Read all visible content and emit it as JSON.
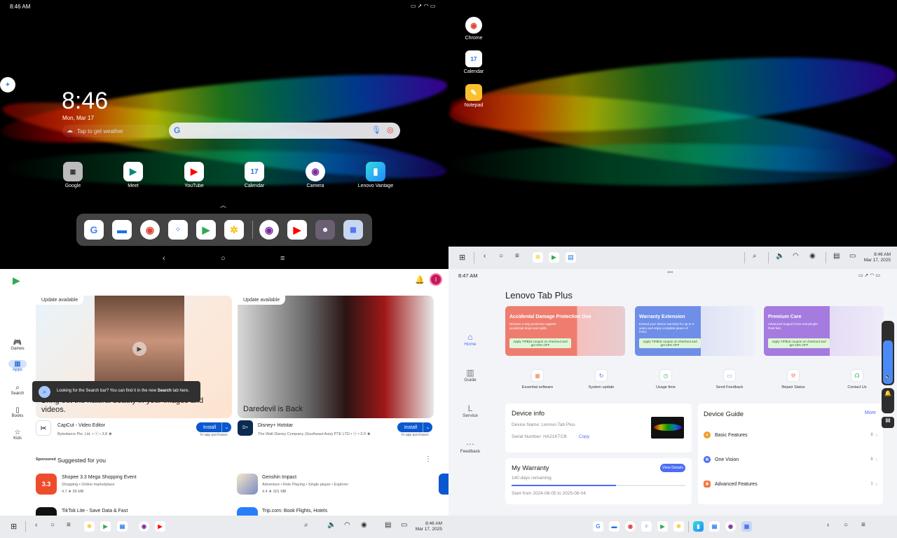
{
  "colors": {
    "play_blue": "#0b57d0",
    "lenovo_blue": "#4a6cf7",
    "promo1": "#ee7d6f",
    "promo2": "#6e8ee8",
    "promo3": "#a57be0"
  },
  "home": {
    "status_time": "8:46 AM",
    "clock": "8:46",
    "date": "Mon, Mar 17",
    "weather": "Tap to get weather",
    "apps": [
      {
        "label": "Google",
        "icon": "google-folder-icon"
      },
      {
        "label": "Meet",
        "icon": "meet-icon"
      },
      {
        "label": "YouTube",
        "icon": "youtube-icon"
      },
      {
        "label": "Calendar",
        "icon": "calendar-icon"
      },
      {
        "label": "Camera",
        "icon": "camera-icon"
      },
      {
        "label": "Lenovo Vantage",
        "icon": "lenovo-vantage-icon"
      }
    ],
    "calendar_day": "17"
  },
  "desktop": {
    "apps": [
      {
        "label": "Chrome",
        "icon": "chrome-icon"
      },
      {
        "label": "Calendar",
        "icon": "calendar-icon"
      },
      {
        "label": "Notepad",
        "icon": "notepad-icon"
      }
    ],
    "calendar_day": "17",
    "taskbar_time": "8:46 AM",
    "taskbar_date": "Mar 17, 2025"
  },
  "play": {
    "cards": [
      {
        "badge": "Update available",
        "caption": "Bring out the natural beauty in your images and videos.",
        "app": "CapCut - Video Editor",
        "dev": "Bytedance Pte. Ltd. • ⓔ • 3.8 ★",
        "install": "Install",
        "note": "In-app purchases"
      },
      {
        "badge": "Update available",
        "caption": "Daredevil is Back",
        "app": "Disney+ Hotstar",
        "dev": "The Walt Disney Company (Southeast Asia) PTE LTD • ⓔ • 3.0 ★",
        "install": "Install",
        "note": "In-app purchases"
      }
    ],
    "tooltip_prefix": "Looking for the Search bar? You can find it in the new ",
    "tooltip_bold": "Search",
    "tooltip_suffix": " tab here.",
    "sponsored": "Sponsored",
    "suggested": "Suggested for you",
    "list": [
      {
        "name": "Shopee 3.3 Mega Shopping Event",
        "cat": "Shopping • Online marketplace",
        "meta": "4.7 ★   95 MB",
        "icon_text": "3.3"
      },
      {
        "name": "Genshin Impact",
        "cat": "Adventure • Role Playing • Single player • Explorer",
        "meta": "4.4 ★   301 MB",
        "icon_text": ""
      },
      {
        "name": "TikTok Lite - Save Data & Fast",
        "cat": "",
        "meta": "",
        "icon_text": ""
      },
      {
        "name": "Trip.com: Book Flights, Hotels",
        "cat": "",
        "meta": "",
        "icon_text": ""
      }
    ],
    "nav": [
      {
        "label": "Games",
        "glyph": "🎮"
      },
      {
        "label": "Apps",
        "glyph": "▦"
      },
      {
        "label": "Search",
        "glyph": "⌕"
      },
      {
        "label": "Books",
        "glyph": "▯"
      },
      {
        "label": "Kids",
        "glyph": "☆"
      }
    ],
    "avatar": "I",
    "taskbar_time": "8:46 AM",
    "taskbar_date": "Mar 17, 2025"
  },
  "vantage": {
    "status_time": "8:47 AM",
    "title": "Lenovo Tab Plus",
    "nav": [
      {
        "label": "Home",
        "glyph": "⌂"
      },
      {
        "label": "Guide",
        "glyph": "▥"
      },
      {
        "label": "Service",
        "glyph": "L"
      },
      {
        "label": "Feedback",
        "glyph": "⋯"
      }
    ],
    "promos": [
      {
        "title": "Accidental Damage Protection One",
        "desc": "Receive a stop protection against accidental drops and spills.",
        "coupon": "Apply TIP$15 coupon on checkout and get 20% OFF"
      },
      {
        "title": "Warranty Extension",
        "desc": "Extend your device warranty for up to 3 years and enjoy complete peace of mind.",
        "coupon": "Apply TIP$15 coupon on checkout and get 15% OFF"
      },
      {
        "title": "Premium Care",
        "desc": "Advanced Support from real people. Real fast.",
        "coupon": "Apply TIP$15 coupon on checkout and get 15% OFF"
      }
    ],
    "quick": [
      "Essential software",
      "System update",
      "Usage time",
      "Send Feedback",
      "Repair Status",
      "Contact Us"
    ],
    "device_info": {
      "title": "Device info",
      "name": "Device Name: Lenovo Tab Plus",
      "serial": "Serial Number: HA21KTCB",
      "copy": "Copy"
    },
    "warranty": {
      "title": "My Warranty",
      "remaining": "140 days remaining",
      "range": "Start from 2024-08-05 to 2025-08-04",
      "details": "View Details",
      "progress": 0.6
    },
    "guide": {
      "title": "Device Guide",
      "more": "More",
      "items": [
        {
          "label": "Basic Features",
          "count": "8"
        },
        {
          "label": "One Vision",
          "count": "8"
        },
        {
          "label": "Advanced Features",
          "count": "1"
        }
      ]
    }
  }
}
